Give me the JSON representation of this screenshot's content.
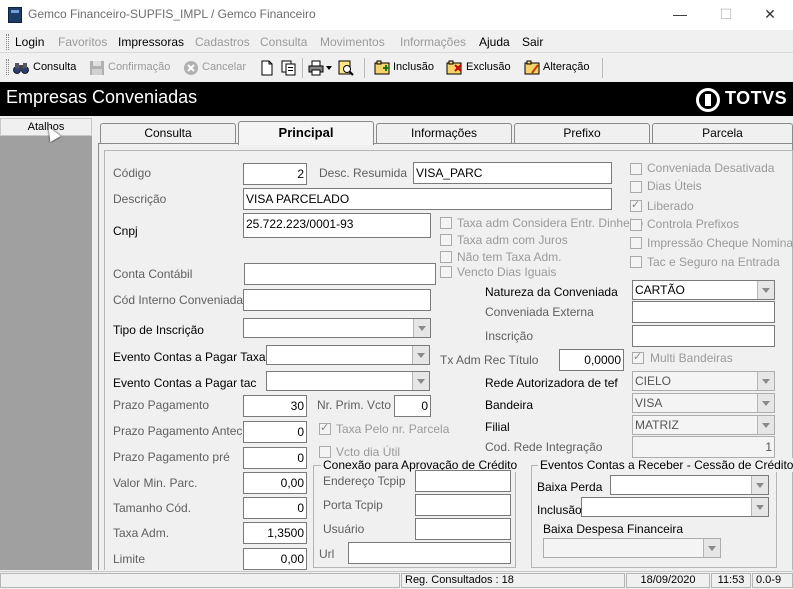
{
  "window": {
    "title": "Gemco Financeiro-SUPFIS_IMPL / Gemco Financeiro",
    "minimize": "—",
    "maximize": "☐",
    "close": "✕"
  },
  "menu": [
    {
      "label": "Login",
      "enabled": true
    },
    {
      "label": "Favoritos",
      "enabled": false
    },
    {
      "label": "Impressoras",
      "enabled": true
    },
    {
      "label": "Cadastros",
      "enabled": false
    },
    {
      "label": "Consulta",
      "enabled": false
    },
    {
      "label": "Movimentos",
      "enabled": false
    },
    {
      "label": "Informações",
      "enabled": false
    },
    {
      "label": "Ajuda",
      "enabled": true
    },
    {
      "label": "Sair",
      "enabled": true
    }
  ],
  "toolbar": {
    "consulta": "Consulta",
    "confirmacao": "Confirmação",
    "cancelar": "Cancelar",
    "inclusao": "Inclusão",
    "exclusao": "Exclusão",
    "alteracao": "Alteração"
  },
  "header": {
    "title": "Empresas Conveniadas",
    "brand": "TOTVS"
  },
  "sidebar": {
    "atalhos": "Atalhos"
  },
  "tabs": [
    "Consulta",
    "Principal",
    "Informações",
    "Prefixo",
    "Parcela"
  ],
  "form": {
    "codigo_label": "Código",
    "codigo_value": "2",
    "desc_resumida_label": "Desc. Resumida",
    "desc_resumida_value": "VISA_PARC",
    "descricao_label": "Descrição",
    "descricao_value": "VISA PARCELADO",
    "cnpj_label": "Cnpj",
    "cnpj_value": "25.722.223/0001-93",
    "conta_contabil_label": "Conta Contábil",
    "cod_interno_label": "Cód Interno Conveniada",
    "tipo_inscricao_label": "Tipo de Inscrição",
    "evento_taxa_label": "Evento Contas a Pagar Taxa",
    "evento_tac_label": "Evento Contas a Pagar tac",
    "prazo_pagamento_label": "Prazo Pagamento",
    "prazo_pagamento_value": "30",
    "prazo_antec_label": "Prazo Pagamento Antec.",
    "prazo_antec_value": "0",
    "prazo_pre_label": "Prazo Pagamento pré",
    "prazo_pre_value": "0",
    "valor_min_label": "Valor Min. Parc.",
    "valor_min_value": "0,00",
    "tamanho_cod_label": "Tamanho Cód.",
    "tamanho_cod_value": "0",
    "taxa_adm_label": "Taxa Adm.",
    "taxa_adm_value": "1,3500",
    "limite_label": "Limite",
    "limite_value": "0,00",
    "nr_prim_vcto_label": "Nr. Prim. Vcto",
    "nr_prim_vcto_value": "0",
    "taxa_pelo_nr_label": "Taxa Pelo nr. Parcela",
    "vcto_dia_util_label": "Vcto dia Útil",
    "taxa_adm_entr_label": "Taxa adm Considera Entr. Dinheiro",
    "taxa_adm_juros_label": "Taxa adm com Juros",
    "nao_tem_taxa_label": "Não tem Taxa Adm.",
    "vencto_dias_iguais_label": "Vencto Dias Iguais",
    "conveniada_desativada_label": "Conveniada Desativada",
    "dias_uteis_label": "Dias Úteis",
    "liberado_label": "Liberado",
    "controla_prefixos_label": "Controla Prefixos",
    "impressao_cheque_label": "Impressão Cheque Nominal",
    "tac_seguro_label": "Tac e Seguro na Entrada",
    "natureza_label": "Natureza da Conveniada",
    "natureza_value": "CARTÃO",
    "conveniada_externa_label": "Conveniada Externa",
    "inscricao_label": "Inscrição",
    "tx_adm_rec_label": "Tx Adm Rec Título",
    "tx_adm_rec_value": "0,0000",
    "multi_bandeiras_label": "Multi Bandeiras",
    "rede_autorizadora_label": "Rede Autorizadora de tef",
    "rede_autorizadora_value": "CIELO",
    "bandeira_label": "Bandeira",
    "bandeira_value": "VISA",
    "filial_label": "Filial",
    "filial_value": "MATRIZ",
    "cod_rede_label": "Cod. Rede Integração",
    "cod_rede_value": "1"
  },
  "conexao": {
    "title": "Conexão para Aprovação de Crédito",
    "endereco_label": "Endereço Tcpip",
    "porta_label": "Porta Tcpip",
    "usuario_label": "Usuário",
    "url_label": "Url"
  },
  "eventos": {
    "title": "Eventos Contas a Receber - Cessão de Crédito",
    "baixa_perda_label": "Baixa Perda",
    "inclusao_label": "Inclusão",
    "baixa_despesa_label": "Baixa Despesa Financeira"
  },
  "status": {
    "reg_consultados": "Reg. Consultados : 18",
    "date": "18/09/2020",
    "time": "11:53",
    "version": "0.0-9"
  },
  "colors": {
    "header_bg": "#000000",
    "sidebar_bg": "#a0a0a0",
    "window_bg": "#f0f0f0"
  }
}
